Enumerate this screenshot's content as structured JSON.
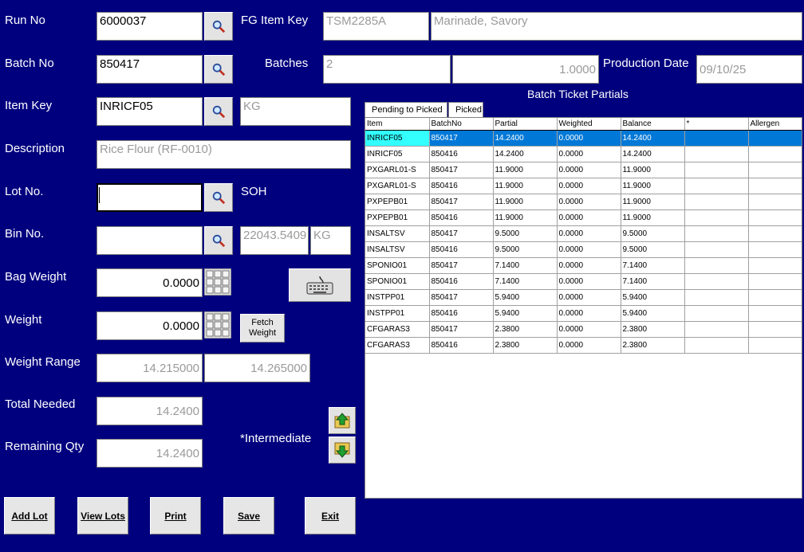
{
  "labels": {
    "run_no": "Run No",
    "batch_no": "Batch No",
    "item_key": "Item Key",
    "description": "Description",
    "lot_no": "Lot No.",
    "bin_no": "Bin No.",
    "bag_weight": "Bag Weight",
    "weight": "Weight",
    "weight_range": "Weight Range",
    "total_needed": "Total Needed",
    "remaining_qty": "Remaining Qty",
    "fg_item_key": "FG Item Key",
    "batches": "Batches",
    "at": "@",
    "production_date": "Production Date",
    "soh": "SOH",
    "intermediate": "*Intermediate"
  },
  "fields": {
    "run_no": "6000037",
    "batch_no": "850417",
    "item_key": "INRICF05",
    "item_uom": "KG",
    "description": "Rice Flour (RF-0010)",
    "lot_no": "",
    "bin_no": "",
    "soh_value": "22043.5409",
    "soh_uom": "KG",
    "bag_weight": "0.0000",
    "weight": "0.0000",
    "weight_range_min": "14.215000",
    "weight_range_max": "14.265000",
    "total_needed": "14.2400",
    "remaining_qty": "14.2400",
    "fg_item_key": "TSM2285A",
    "fg_item_desc": "Marinade, Savory",
    "batches": "2",
    "batch_factor": "1.0000",
    "production_date": "09/10/25"
  },
  "buttons": {
    "fetch_weight_line1": "Fetch",
    "fetch_weight_line2": "Weight",
    "add_lot": "Add Lot",
    "view_lots": "View Lots",
    "print": "Print",
    "save": "Save",
    "exit": "Exit"
  },
  "grid": {
    "title": "Batch Ticket Partials",
    "tabs": [
      "Pending to Picked",
      "Picked"
    ],
    "columns": [
      "Item",
      "BatchNo",
      "Partial",
      "Weighted",
      "Balance",
      "*",
      "Allergen"
    ],
    "rows": [
      [
        "INRICF05",
        "850417",
        "14.2400",
        "0.0000",
        "14.2400",
        "",
        ""
      ],
      [
        "INRICF05",
        "850416",
        "14.2400",
        "0.0000",
        "14.2400",
        "",
        ""
      ],
      [
        "PXGARL01-S",
        "850417",
        "11.9000",
        "0.0000",
        "11.9000",
        "",
        ""
      ],
      [
        "PXGARL01-S",
        "850416",
        "11.9000",
        "0.0000",
        "11.9000",
        "",
        ""
      ],
      [
        "PXPEPB01",
        "850417",
        "11.9000",
        "0.0000",
        "11.9000",
        "",
        ""
      ],
      [
        "PXPEPB01",
        "850416",
        "11.9000",
        "0.0000",
        "11.9000",
        "",
        ""
      ],
      [
        "INSALTSV",
        "850417",
        "9.5000",
        "0.0000",
        "9.5000",
        "",
        ""
      ],
      [
        "INSALTSV",
        "850416",
        "9.5000",
        "0.0000",
        "9.5000",
        "",
        ""
      ],
      [
        "SPONIO01",
        "850417",
        "7.1400",
        "0.0000",
        "7.1400",
        "",
        ""
      ],
      [
        "SPONIO01",
        "850416",
        "7.1400",
        "0.0000",
        "7.1400",
        "",
        ""
      ],
      [
        "INSTPP01",
        "850417",
        "5.9400",
        "0.0000",
        "5.9400",
        "",
        ""
      ],
      [
        "INSTPP01",
        "850416",
        "5.9400",
        "0.0000",
        "5.9400",
        "",
        ""
      ],
      [
        "CFGARAS3",
        "850417",
        "2.3800",
        "0.0000",
        "2.3800",
        "",
        ""
      ],
      [
        "CFGARAS3",
        "850416",
        "2.3800",
        "0.0000",
        "2.3800",
        "",
        ""
      ]
    ],
    "selected_row": 0
  },
  "colors": {
    "background": "#00007f",
    "selection": "#0078d7",
    "selection_first_cell": "#33ffff"
  },
  "icons": [
    "search-icon",
    "keypad-icon",
    "keyboard-icon",
    "arrow-up-icon",
    "arrow-down-icon"
  ]
}
